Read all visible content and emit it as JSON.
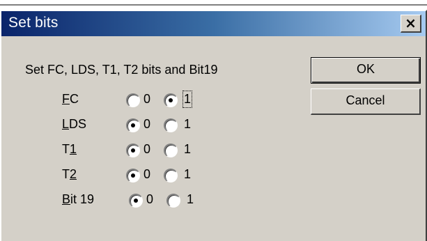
{
  "window": {
    "title": "Set bits",
    "close_glyph": "×"
  },
  "instruction": "Set FC, LDS, T1, T2 bits and Bit19",
  "buttons": {
    "ok": "OK",
    "cancel": "Cancel"
  },
  "rows": [
    {
      "label_pre": "",
      "label_ul": "F",
      "label_post": "C",
      "selected": "1",
      "option0": "0",
      "option1": "1"
    },
    {
      "label_pre": "",
      "label_ul": "L",
      "label_post": "DS",
      "selected": "0",
      "option0": "0",
      "option1": "1"
    },
    {
      "label_pre": "T",
      "label_ul": "1",
      "label_post": "",
      "selected": "0",
      "option0": "0",
      "option1": "1"
    },
    {
      "label_pre": "T",
      "label_ul": "2",
      "label_post": "",
      "selected": "0",
      "option0": "0",
      "option1": "1"
    },
    {
      "label_pre": "",
      "label_ul": "B",
      "label_post": "it 19",
      "selected": "0",
      "option0": "0",
      "option1": "1"
    }
  ]
}
